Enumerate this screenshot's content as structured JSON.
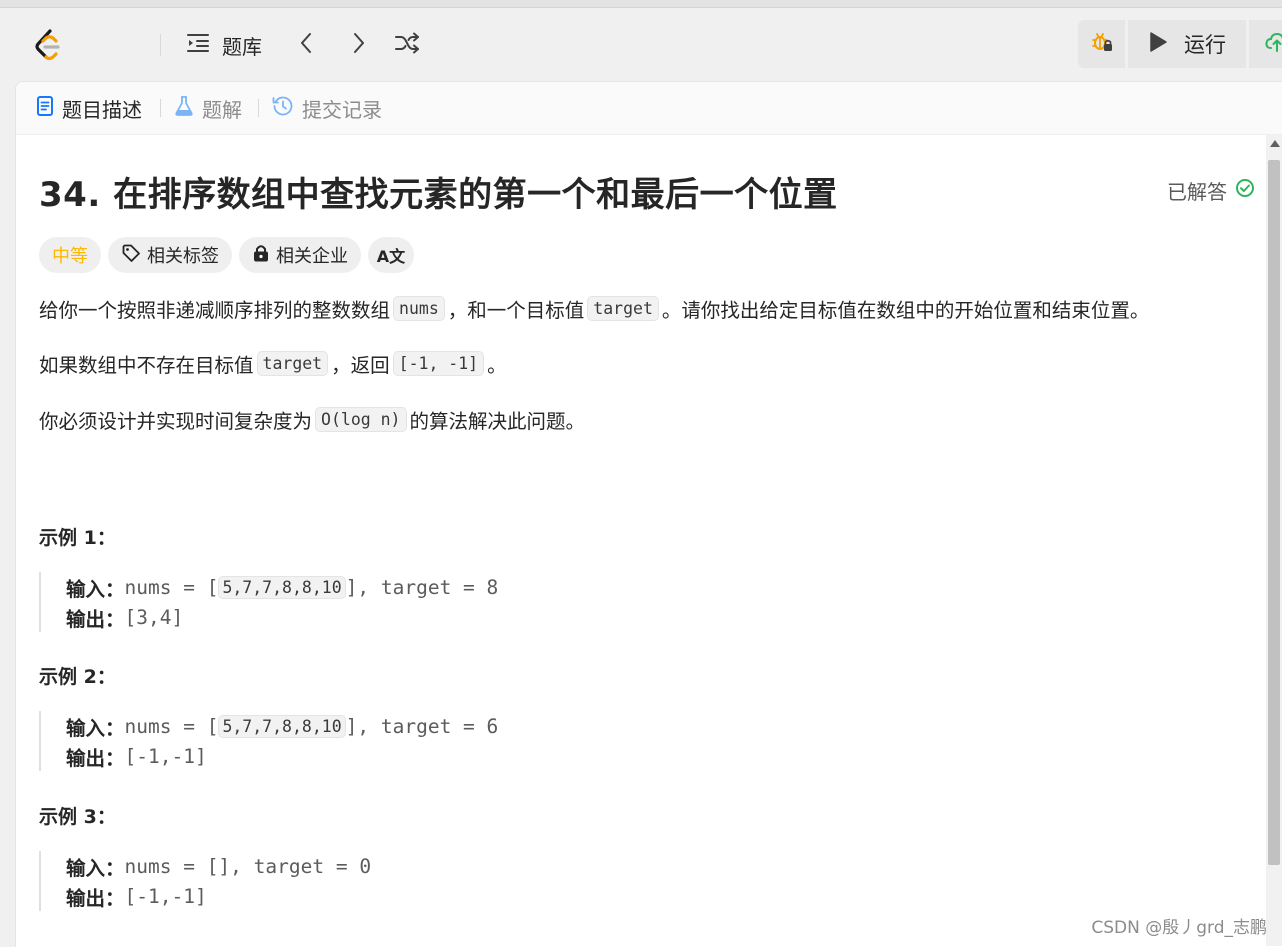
{
  "nav": {
    "problems_label": "题库",
    "icons": [
      "leetcode-logo",
      "list-icon",
      "chevron-left-icon",
      "chevron-right-icon",
      "shuffle-icon"
    ]
  },
  "toolbar": {
    "run_label": "运行",
    "icons": [
      "debug-lock-icon",
      "play-icon",
      "upload-icon"
    ]
  },
  "tabs": [
    {
      "label": "题目描述",
      "active": true,
      "icon": "document-icon"
    },
    {
      "label": "题解",
      "active": false,
      "icon": "flask-icon"
    },
    {
      "label": "提交记录",
      "active": false,
      "icon": "history-icon"
    }
  ],
  "problem": {
    "title": "34. 在排序数组中查找元素的第一个和最后一个位置",
    "status": "已解答",
    "difficulty": "中等",
    "tags": {
      "related_tags": "相关标签",
      "related_companies": "相关企业",
      "translate": "A文"
    }
  },
  "description": {
    "p1": {
      "t1": "给你一个按照非递减顺序排列的整数数组",
      "c1": "nums",
      "t2": "，和一个目标值",
      "c2": "target",
      "t3": "。请你找出给定目标值在数组中的开始位置和结束位置。"
    },
    "p2": {
      "t1": "如果数组中不存在目标值",
      "c1": "target",
      "t2": "，返回",
      "c2": "[-1, -1]",
      "t3": "。"
    },
    "p3": {
      "t1": "你必须设计并实现时间复杂度为",
      "c1": "O(log n)",
      "t2": "的算法解决此问题。"
    }
  },
  "examples": [
    {
      "title": "示例 1：",
      "input_label": "输入：",
      "input_pre": "nums = [",
      "input_array": "5,7,7,8,8,10",
      "input_post": "], target = 8",
      "output_label": "输出：",
      "output": "[3,4]"
    },
    {
      "title": "示例 2：",
      "input_label": "输入：",
      "input_pre": "nums = [",
      "input_array": "5,7,7,8,8,10",
      "input_post": "], target = 6",
      "output_label": "输出：",
      "output": "[-1,-1]"
    },
    {
      "title": "示例 3：",
      "input_label": "输入：",
      "input_text": "nums = [], target = 0",
      "output_label": "输出：",
      "output": "[-1,-1]"
    }
  ],
  "watermark": "CSDN @殷丿grd_志鹏",
  "colors": {
    "difficulty_medium": "#ffb800",
    "solved_check": "#2db55d",
    "tab_icon_active": "#1677ff"
  }
}
